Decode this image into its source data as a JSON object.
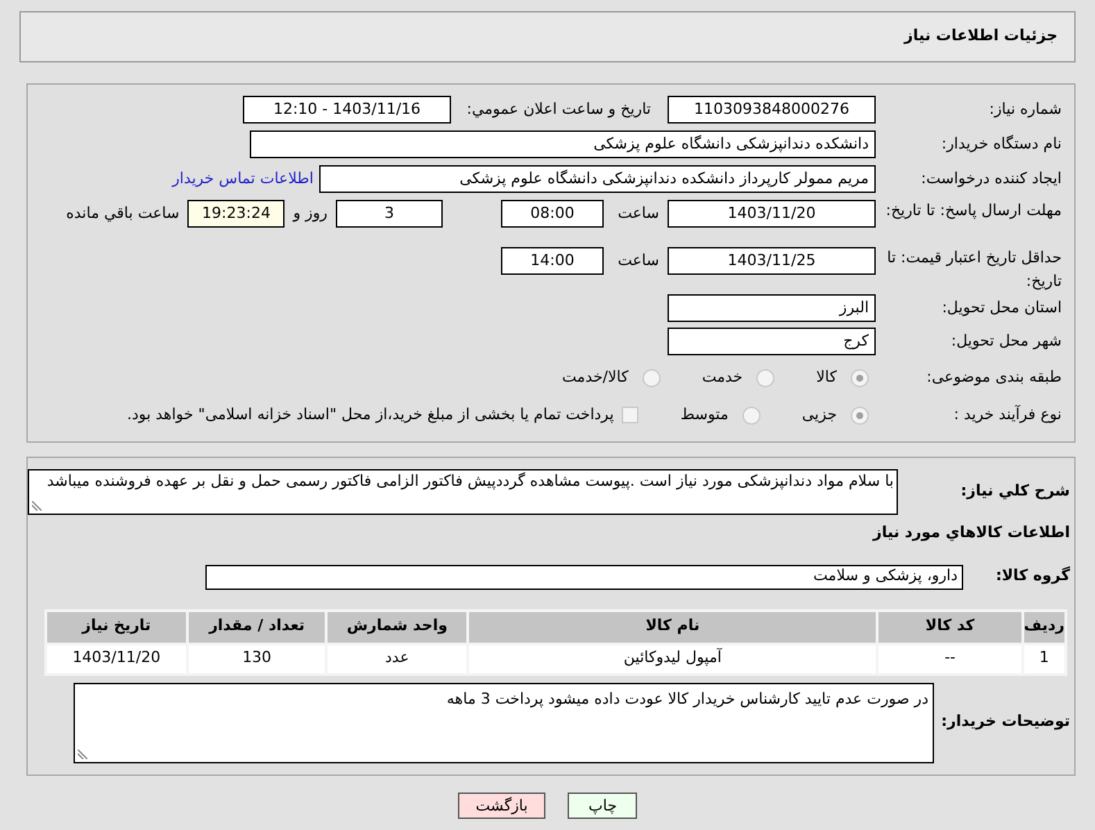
{
  "header": {
    "title": "جزئیات اطلاعات نیاز"
  },
  "details": {
    "need_number": {
      "label": "شماره نیاز:",
      "value": "1103093848000276"
    },
    "announce": {
      "label": "تاریخ و ساعت اعلان عمومي:",
      "value": "1403/11/16 - 12:10"
    },
    "buyer_org": {
      "label": "نام دستگاه خریدار:",
      "value": "دانشکده دندانپزشکی دانشگاه علوم پزشکی"
    },
    "creator": {
      "label": "ایجاد کننده درخواست:",
      "value": "مریم ممولر کارپرداز دانشکده دندانپزشکی دانشگاه علوم پزشکی",
      "link": "اطلاعات تماس خریدار"
    },
    "reply_deadline": {
      "label": "مهلت ارسال پاسخ: تا تاریخ:",
      "date": "1403/11/20",
      "time_label": "ساعت",
      "time": "08:00",
      "days": "3",
      "days_label": "روز و",
      "remaining": "19:23:24",
      "remaining_label": "ساعت باقي مانده"
    },
    "price_validity": {
      "label": "حداقل تاریخ اعتبار قیمت: تا تاریخ:",
      "date": "1403/11/25",
      "time_label": "ساعت",
      "time": "14:00"
    },
    "province": {
      "label": "استان محل تحویل:",
      "value": "البرز"
    },
    "city": {
      "label": "شهر محل تحویل:",
      "value": "کرج"
    },
    "category": {
      "label": "طبقه بندی موضوعی:",
      "options": [
        {
          "label": "کالا",
          "selected": true
        },
        {
          "label": "خدمت",
          "selected": false
        },
        {
          "label": "کالا/خدمت",
          "selected": false
        }
      ]
    },
    "purchase_type": {
      "label": "نوع فرآیند خرید :",
      "options": [
        {
          "label": "جزیی",
          "selected": true
        },
        {
          "label": "متوسط",
          "selected": false
        }
      ],
      "treasury": {
        "label": "پرداخت تمام یا بخشی از مبلغ خرید،از محل \"اسناد خزانه اسلامی\" خواهد بود.",
        "checked": false
      }
    }
  },
  "needs": {
    "description": {
      "label": "شرح كلي نياز:",
      "value": "با سلام مواد دندانپزشکی مورد نیاز است .پیوست مشاهده گرددپیش فاکتور الزامی فاکتور رسمی حمل و نقل بر عهده فروشنده میباشد"
    },
    "goods_title": "اطلاعات كالاهاي مورد نياز",
    "goods_group": {
      "label": "گروه کالا:",
      "value": "دارو، پزشکی و سلامت"
    },
    "table": {
      "columns": [
        "ردیف",
        "کد کالا",
        "نام کالا",
        "واحد شمارش",
        "تعداد / مقدار",
        "تاریخ نیاز"
      ],
      "rows": [
        [
          "1",
          "--",
          "آمپول لیدوکائین",
          "عدد",
          "130",
          "1403/11/20"
        ]
      ]
    },
    "buyer_notes": {
      "label": "توضیحات خریدار:",
      "value": "در صورت عدم تایید کارشناس خریدار کالا عودت داده میشود پرداخت 3 ماهه"
    }
  },
  "buttons": [
    {
      "label": "چاپ",
      "color": "#eeffee"
    },
    {
      "label": "بازگشت",
      "color": "#ffdddd"
    }
  ]
}
